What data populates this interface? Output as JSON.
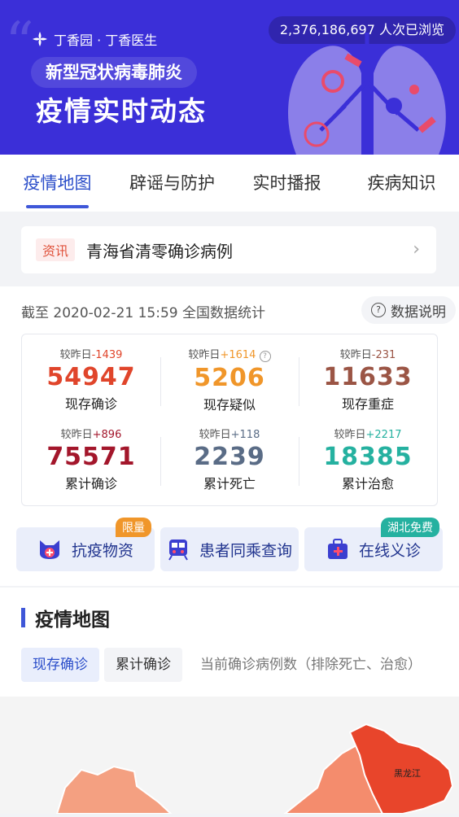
{
  "header": {
    "brand": "丁香园 · 丁香医生",
    "views": "2,376,186,697 人次已浏览",
    "subtitle": "新型冠状病毒肺炎",
    "title": "疫情实时动态"
  },
  "tabs": [
    {
      "label": "疫情地图",
      "active": true
    },
    {
      "label": "辟谣与防护"
    },
    {
      "label": "实时播报"
    },
    {
      "label": "疾病知识"
    }
  ],
  "notice": {
    "tag": "资讯",
    "text": "青海省清零确诊病例"
  },
  "stats": {
    "as_of": "截至 2020-02-21 15:59 全国数据统计",
    "explain_label": "数据说明",
    "compare_prefix": "较昨日",
    "items": [
      {
        "delta": "-1439",
        "value": "54947",
        "label": "现存确诊",
        "color": "#e0452b",
        "delta_color": "#e0452b"
      },
      {
        "delta": "+1614",
        "value": "5206",
        "label": "现存疑似",
        "color": "#f0962a",
        "delta_color": "#f0962a"
      },
      {
        "delta": "-231",
        "value": "11633",
        "label": "现存重症",
        "color": "#9b5545",
        "delta_color": "#9b5545"
      },
      {
        "delta": "+896",
        "value": "75571",
        "label": "累计确诊",
        "color": "#a3162b",
        "delta_color": "#a3162b"
      },
      {
        "delta": "+118",
        "value": "2239",
        "label": "累计死亡",
        "color": "#5a6c86",
        "delta_color": "#5a6c86"
      },
      {
        "delta": "+2217",
        "value": "18385",
        "label": "累计治愈",
        "color": "#25b1a0",
        "delta_color": "#25b1a0"
      }
    ]
  },
  "actions": [
    {
      "label": "抗疫物资",
      "badge": "限量",
      "badge_color": "#f0962a",
      "icon": "cat-face-icon"
    },
    {
      "label": "患者同乘查询",
      "icon": "train-icon"
    },
    {
      "label": "在线义诊",
      "badge": "湖北免费",
      "badge_color": "#25b1a0",
      "icon": "medical-kit-icon"
    }
  ],
  "map": {
    "title": "疫情地图",
    "filters": [
      "现存确诊",
      "累计确诊"
    ],
    "description": "当前确诊病例数（排除死亡、治愈）",
    "province_label": "黑龙江"
  }
}
